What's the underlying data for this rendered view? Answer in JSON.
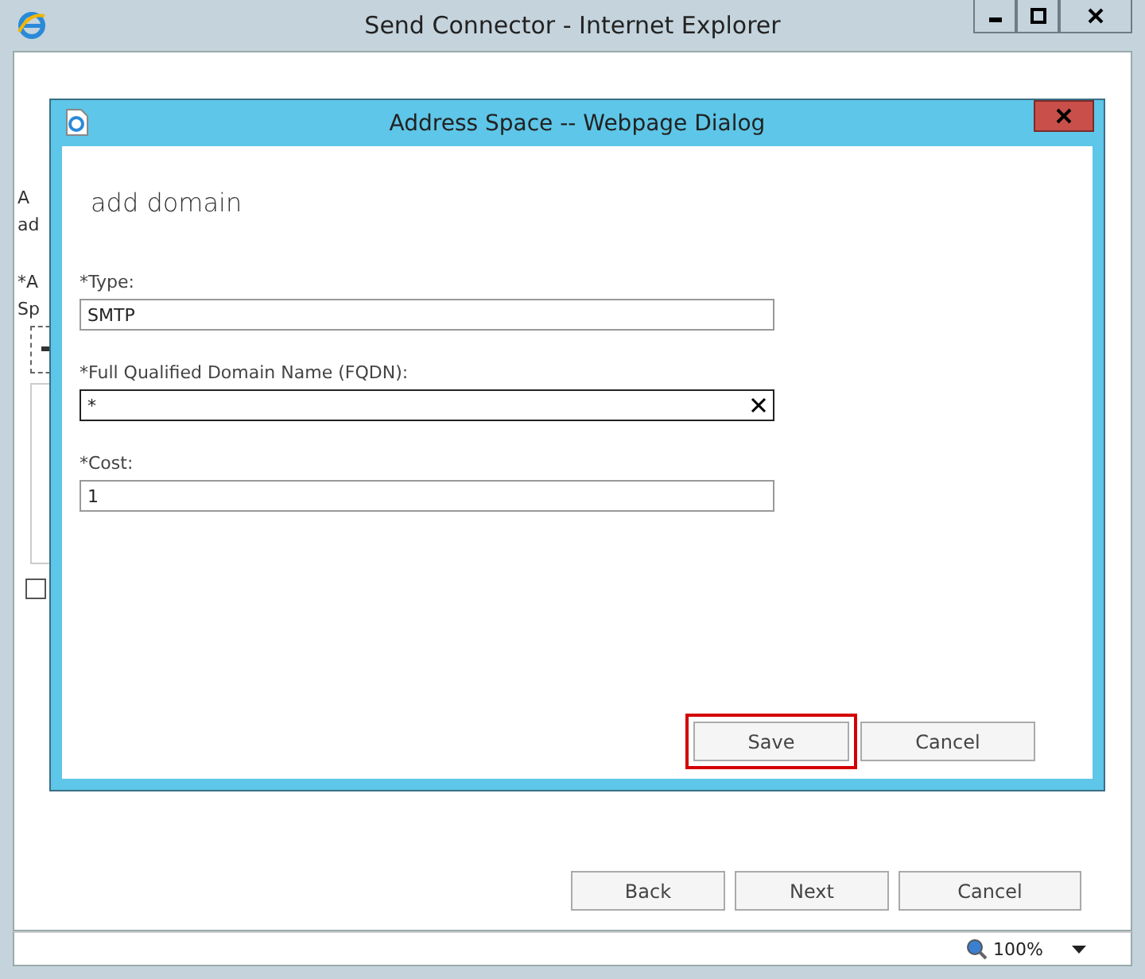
{
  "window": {
    "title": "Send Connector - Internet Explorer"
  },
  "background_page": {
    "texts": [
      "A",
      "ad",
      "*A",
      "Sp"
    ],
    "checkbox": {
      "checked": false
    },
    "buttons": [
      "Back",
      "Next",
      "Cancel"
    ]
  },
  "dialog": {
    "title": "Address Space -- Webpage Dialog",
    "heading": "add domain",
    "fields": [
      {
        "label": "*Type:",
        "value": "SMTP",
        "focused": false,
        "clearable": false
      },
      {
        "label": "*Full Qualified Domain Name (FQDN):",
        "value": "*",
        "focused": true,
        "clearable": true
      },
      {
        "label": "*Cost:",
        "value": "1",
        "focused": false,
        "clearable": false
      }
    ],
    "buttons": [
      {
        "label": "Save",
        "highlighted": true
      },
      {
        "label": "Cancel",
        "highlighted": false
      }
    ]
  },
  "status_bar": {
    "zoom": "100%"
  }
}
